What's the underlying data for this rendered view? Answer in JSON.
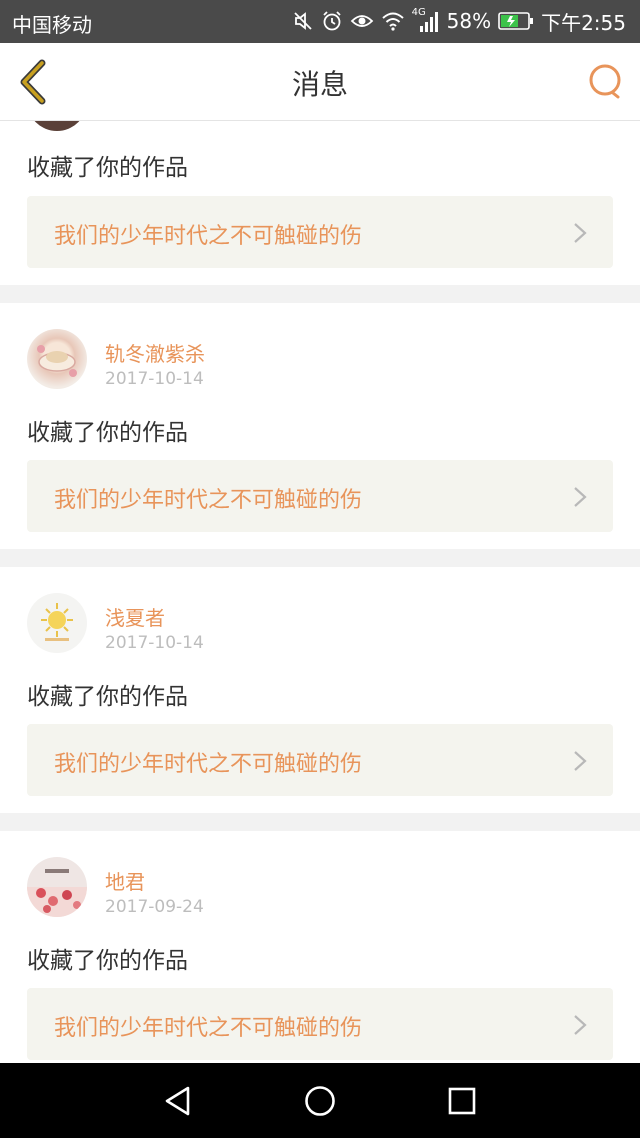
{
  "status_bar": {
    "carrier": "中国移动",
    "network": "4G",
    "battery": "58%",
    "time": "下午2:55",
    "icons": [
      "mute-icon",
      "alarm-icon",
      "eye-icon",
      "wifi-icon",
      "signal-icon",
      "battery-icon"
    ]
  },
  "header": {
    "title": "消息",
    "back_icon": "back-chevron-icon",
    "search_icon": "search-icon"
  },
  "messages": [
    {
      "action": "收藏了你的作品",
      "work_title": "我们的少年时代之不可触碰的伤"
    },
    {
      "username": "轨冬澈紫杀",
      "date": "2017-10-14",
      "action": "收藏了你的作品",
      "work_title": "我们的少年时代之不可触碰的伤"
    },
    {
      "username": "浅夏者",
      "date": "2017-10-14",
      "action": "收藏了你的作品",
      "work_title": "我们的少年时代之不可触碰的伤"
    },
    {
      "username": "地君",
      "date": "2017-09-24",
      "action": "收藏了你的作品",
      "work_title": "我们的少年时代之不可触碰的伤"
    }
  ],
  "colors": {
    "accent": "#e8945a",
    "back_icon": "#c8a020",
    "card_bg": "#f4f4ee"
  },
  "system_nav": [
    "back-triangle-icon",
    "home-circle-icon",
    "recents-square-icon"
  ]
}
